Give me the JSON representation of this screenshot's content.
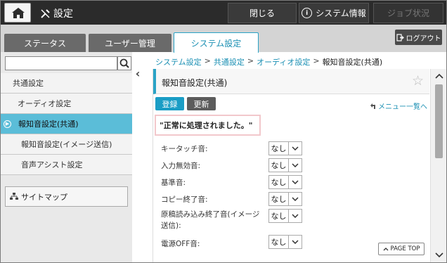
{
  "topbar": {
    "settings_label": "設定",
    "close_label": "閉じる",
    "system_info_label": "システム情報",
    "job_status_label": "ジョブ状況"
  },
  "tabs": [
    {
      "label": "ステータス"
    },
    {
      "label": "ユーザー管理"
    },
    {
      "label": "システム設定"
    }
  ],
  "logout_label": "ログアウト",
  "sidebar": {
    "search_placeholder": "",
    "items": [
      {
        "label": "共通設定"
      },
      {
        "label": "オーディオ設定"
      },
      {
        "label": "報知音設定(共通)"
      },
      {
        "label": "報知音設定(イメージ送信)"
      },
      {
        "label": "音声アシスト設定"
      }
    ],
    "sitemap_label": "サイトマップ"
  },
  "breadcrumb": {
    "items": [
      "システム設定",
      "共通設定",
      "オーディオ設定"
    ],
    "current": "報知音設定(共通)",
    "separator": ">"
  },
  "page": {
    "title": "報知音設定(共通)",
    "register_label": "登録",
    "update_label": "更新",
    "menu_link_label": "メニュー一覧へ",
    "message": "\"正常に処理されました。\""
  },
  "settings": [
    {
      "label": "キータッチ音:",
      "value": "なし"
    },
    {
      "label": "入力無効音:",
      "value": "なし"
    },
    {
      "label": "基準音:",
      "value": "なし"
    },
    {
      "label": "コピー終了音:",
      "value": "なし"
    },
    {
      "label": "原稿読み込み終了音(イメージ送信):",
      "value": "なし"
    },
    {
      "label": "電源OFF音:",
      "value": "なし"
    }
  ],
  "page_top_label": "PAGE TOP",
  "colors": {
    "accent": "#2aa3c6",
    "active_nav": "#5bbdd8",
    "topbar": "#2b2b2b",
    "message_border": "#f2c8cc"
  }
}
